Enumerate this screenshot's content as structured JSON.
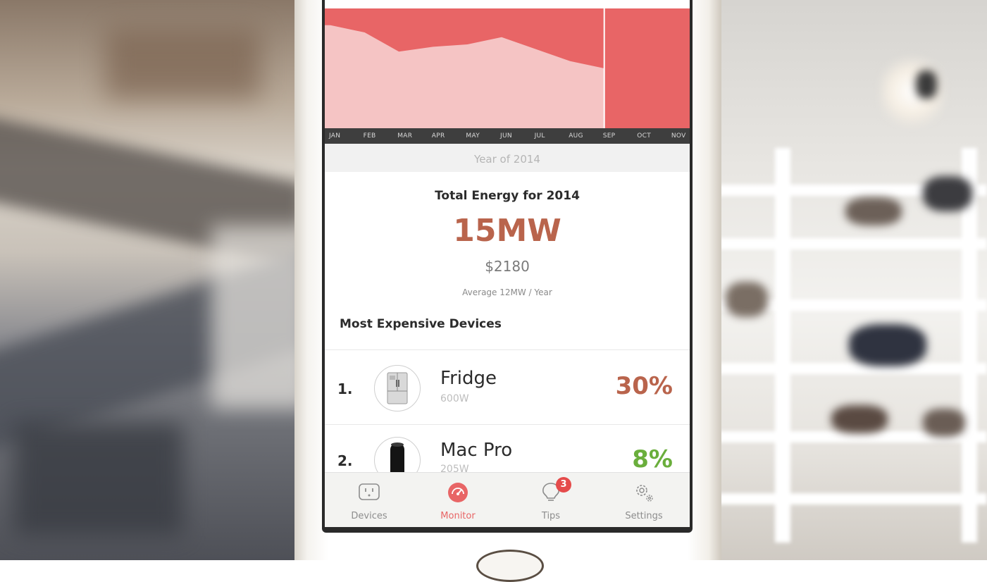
{
  "colors": {
    "accent": "#e86566",
    "chart_fill_past": "#f5c4c4",
    "primary_value": "#b9644c",
    "secondary_value": "#6aae3c",
    "badge": "#e54b4b"
  },
  "chart_data": {
    "type": "area",
    "categories": [
      "JAN",
      "FEB",
      "MAR",
      "APR",
      "MAY",
      "JUN",
      "JUL",
      "AUG",
      "SEP",
      "OCT",
      "NOV"
    ],
    "series": [
      {
        "values": [
          0.86,
          0.8,
          0.64,
          0.68,
          0.7,
          0.76,
          0.66,
          0.56,
          0.5
        ]
      }
    ],
    "current_index": 8,
    "ylim": [
      0,
      1
    ],
    "grid": false
  },
  "chart": {
    "year_label": "Year of 2014"
  },
  "summary": {
    "title": "Total Energy for 2014",
    "value": "15MW",
    "cost": "$2180",
    "average": "Average 12MW / Year"
  },
  "devices_section": {
    "title": "Most Expensive Devices",
    "items": [
      {
        "rank": "1.",
        "name": "Fridge",
        "power": "600W",
        "percent": "30%",
        "icon": "fridge-icon"
      },
      {
        "rank": "2.",
        "name": "Mac Pro",
        "power": "205W",
        "percent": "8%",
        "icon": "mac-pro-icon"
      }
    ]
  },
  "tabbar": {
    "tabs": [
      {
        "label": "Devices",
        "icon": "outlet-icon",
        "active": false
      },
      {
        "label": "Monitor",
        "icon": "gauge-icon",
        "active": true
      },
      {
        "label": "Tips",
        "icon": "lightbulb-icon",
        "active": false,
        "badge": "3"
      },
      {
        "label": "Settings",
        "icon": "gear-icon",
        "active": false
      }
    ]
  }
}
